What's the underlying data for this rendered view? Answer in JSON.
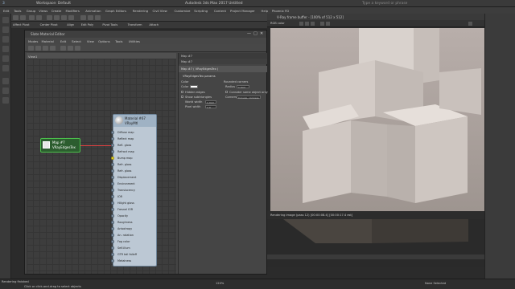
{
  "app": {
    "workspace": "Workspace: Default",
    "title": "Autodesk 3ds Max 2017     Untitled",
    "search_placeholder": "Type a keyword or phrase",
    "main_menu": [
      "Edit",
      "Tools",
      "Group",
      "Views",
      "Create",
      "Modifiers",
      "Animation",
      "Graph Editors",
      "Rendering",
      "Civil View",
      "Customize",
      "Scripting",
      "Content",
      "Project Manager",
      "Help",
      "Phoenix FD"
    ],
    "ribbon": [
      "Affect Pivot",
      "Center Pivot",
      "Align",
      "Edit Poly",
      "Pivot Tools",
      "Transform",
      "Attach"
    ]
  },
  "sme": {
    "title": "Slate Material Editor",
    "menu": [
      "Modes",
      "Material",
      "Edit",
      "Select",
      "View",
      "Options",
      "Tools",
      "Utilities"
    ],
    "view_tab": "View1",
    "map_node": {
      "line1": "Map #7",
      "line2": "VRayEdgesTex"
    },
    "mat_node": {
      "line1": "Material #67",
      "line2": "VRayMtl",
      "slots": [
        "Diffuse map",
        "Reflect map",
        "Refl. gloss",
        "Refract map",
        "Bump map",
        "Refr. gloss",
        "Refr. gloss",
        "Displacement",
        "Environment",
        "Translucency",
        "IOR",
        "Hilight gloss",
        "Fresnel IOR",
        "Opacity",
        "Roughness",
        "Anisotropy",
        "An. rotation",
        "Fog color",
        "Self-illum",
        "GTR tail falloff",
        "Metalness"
      ],
      "connected_slot_index": 4
    },
    "params": {
      "header1": "Map #7",
      "header2": "Map #7",
      "panel_title": "Map #7  ( VRayEdgesTex )",
      "rollout": "VRayEdgesTex params",
      "color_label": "Color",
      "color_field": "Color",
      "hidden_edges": "Hidden edges",
      "show_subtriangles": "Show subtriangles",
      "world_width": "World width",
      "world_width_value": "1.0cm",
      "pixel_width": "Pixel width",
      "pixel_width_value": "1.0",
      "rounded_corners": "Rounded corners",
      "radius_label": "Radius",
      "radius_value": "1.0cm",
      "consider_same": "Consider same object only",
      "corners_label": "Corners",
      "corners_value": "Convex, concave"
    }
  },
  "vfb": {
    "title": "V-Ray frame buffer - [100% of 512 x 512]",
    "channel": "RGB color",
    "status_left": "Rendering image (pass 12) [00:00:08.4] [00:00:17.4 est]"
  },
  "status": {
    "selection": "None Selected",
    "hint": "Click or click-and-drag to select objects",
    "zoom": "120%",
    "left_bottom": "Rendering finished"
  },
  "colors": {
    "accent_green": "#4cc04c",
    "wire_red": "#e04040",
    "render_bg": "#b3aaa6"
  }
}
